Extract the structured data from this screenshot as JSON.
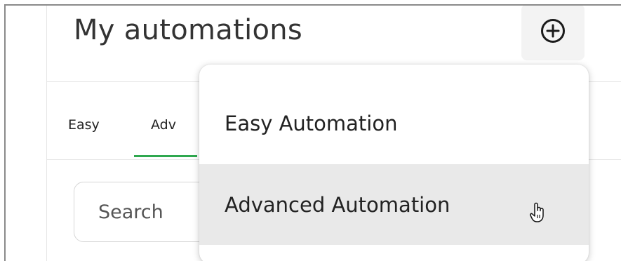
{
  "header": {
    "title": "My automations",
    "add_icon": "plus-circle-icon"
  },
  "tabs": [
    {
      "label": "Easy"
    },
    {
      "label": "Adv"
    }
  ],
  "search": {
    "placeholder": "Search",
    "value": ""
  },
  "dropdown": {
    "items": [
      {
        "label": "Easy Automation"
      },
      {
        "label": "Advanced Automation",
        "hovered": true
      }
    ]
  },
  "colors": {
    "tab_active_underline": "#2fa84f",
    "hover_background": "#e9e9e9",
    "button_background": "#f3f3f3"
  }
}
